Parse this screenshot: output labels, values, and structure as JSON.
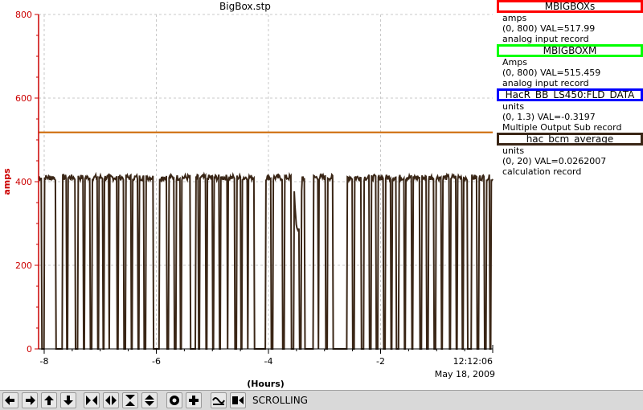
{
  "plot": {
    "title": "BigBox.stp",
    "time_stamp_time": "12:12:06",
    "time_stamp_date": "May 18, 2009"
  },
  "legend": [
    {
      "name": "MBIGBOXs",
      "color": "#ff0000",
      "units": "amps",
      "range_value": "(0, 800)  VAL=517.99",
      "record_type": "analog input record"
    },
    {
      "name": "MBIGBOXM",
      "color": "#00ff00",
      "units": "Amps",
      "range_value": "(0, 800)  VAL=515.459",
      "record_type": "analog input record"
    },
    {
      "name": "HacR_BB_LS450:FLD_DATA",
      "color": "#0000ff",
      "units": "units",
      "range_value": "(0, 1.3)  VAL=-0.3197",
      "record_type": "Multiple Output Sub record"
    },
    {
      "name": "hac_bcm_average",
      "color": "#3a2616",
      "units": "units",
      "range_value": "(0, 20)  VAL=0.0262007",
      "record_type": "calculation record"
    }
  ],
  "toolbar": {
    "status": "SCROLLING",
    "buttons": [
      {
        "icon": "arrow-left-icon",
        "name": "pan-left-button"
      },
      {
        "icon": "arrow-right-icon",
        "name": "pan-right-button"
      },
      {
        "icon": "arrow-up-icon",
        "name": "pan-up-button"
      },
      {
        "icon": "arrow-down-icon",
        "name": "pan-down-button"
      },
      {
        "icon": "zoom-in-x-icon",
        "name": "zoom-in-x-button"
      },
      {
        "icon": "zoom-out-x-icon",
        "name": "zoom-out-x-button"
      },
      {
        "icon": "zoom-in-y-icon",
        "name": "zoom-in-y-button"
      },
      {
        "icon": "zoom-out-y-icon",
        "name": "zoom-out-y-button"
      },
      {
        "icon": "stop-icon",
        "name": "stop-scrolling-button"
      },
      {
        "icon": "plus-icon",
        "name": "add-button"
      },
      {
        "icon": "style-icon",
        "name": "style-button"
      },
      {
        "icon": "scroll-mode-icon",
        "name": "scrolling-button"
      }
    ]
  },
  "chart_data": {
    "type": "line",
    "title": "BigBox.stp",
    "xlabel": "(Hours)",
    "ylabel": "amps",
    "xlim": [
      -8.1,
      0
    ],
    "ylim": [
      0,
      800
    ],
    "x_ticks": [
      -8,
      -6,
      -4,
      -2
    ],
    "y_ticks": [
      0,
      200,
      400,
      600,
      800
    ],
    "grid": true,
    "legend_position": "right",
    "axis_color": "#cc0000",
    "series": [
      {
        "name": "MBIGBOXs",
        "color": "#cc6600",
        "x": [
          -8.1,
          0
        ],
        "y": [
          517.99,
          517.99
        ]
      },
      {
        "name": "MBIGBOXM",
        "color": "#3a2616",
        "y_base": 410,
        "y_low": 0,
        "y_range": [
          -8.1,
          0
        ],
        "dropouts": [
          [
            -8.05,
            -8.0
          ],
          [
            -7.8,
            -7.68
          ],
          [
            -7.6,
            -7.58
          ],
          [
            -7.45,
            -7.4
          ],
          [
            -7.3,
            -7.28
          ],
          [
            -7.18,
            -7.15
          ],
          [
            -7.05,
            -7.03
          ],
          [
            -6.95,
            -6.93
          ],
          [
            -6.85,
            -6.83
          ],
          [
            -6.7,
            -6.68
          ],
          [
            -6.58,
            -6.55
          ],
          [
            -6.45,
            -6.43
          ],
          [
            -6.33,
            -6.31
          ],
          [
            -6.22,
            -6.19
          ],
          [
            -6.05,
            -5.95
          ],
          [
            -5.82,
            -5.78
          ],
          [
            -5.68,
            -5.65
          ],
          [
            -5.58,
            -5.55
          ],
          [
            -5.4,
            -5.3
          ],
          [
            -5.25,
            -5.23
          ],
          [
            -5.12,
            -5.1
          ],
          [
            -5.0,
            -4.97
          ],
          [
            -4.88,
            -4.85
          ],
          [
            -4.74,
            -4.72
          ],
          [
            -4.6,
            -4.57
          ],
          [
            -4.5,
            -4.47
          ],
          [
            -4.38,
            -4.36
          ],
          [
            -4.25,
            -4.05
          ],
          [
            -3.95,
            -3.92
          ],
          [
            -3.75,
            -3.72
          ],
          [
            -3.6,
            -3.55
          ],
          [
            -3.45,
            -3.42
          ],
          [
            -3.35,
            -3.2
          ],
          [
            -3.12,
            -3.1
          ],
          [
            -2.98,
            -2.95
          ],
          [
            -2.85,
            -2.6
          ],
          [
            -2.5,
            -2.47
          ],
          [
            -2.35,
            -2.3
          ],
          [
            -2.2,
            -2.17
          ],
          [
            -2.08,
            -2.05
          ],
          [
            -1.95,
            -1.92
          ],
          [
            -1.82,
            -1.8
          ],
          [
            -1.72,
            -1.68
          ],
          [
            -1.58,
            -1.55
          ],
          [
            -1.45,
            -1.42
          ],
          [
            -1.3,
            -1.27
          ],
          [
            -1.18,
            -1.15
          ],
          [
            -1.05,
            -1.02
          ],
          [
            -0.92,
            -0.89
          ],
          [
            -0.78,
            -0.75
          ],
          [
            -0.66,
            -0.63
          ],
          [
            -0.55,
            -0.52
          ],
          [
            -0.45,
            -0.38
          ],
          [
            -0.28,
            -0.25
          ],
          [
            -0.15,
            -0.12
          ],
          [
            -0.06,
            -0.03
          ]
        ],
        "dip": {
          "x": [
            -3.55,
            -3.4
          ],
          "y": [
            280,
            400
          ]
        }
      }
    ]
  }
}
